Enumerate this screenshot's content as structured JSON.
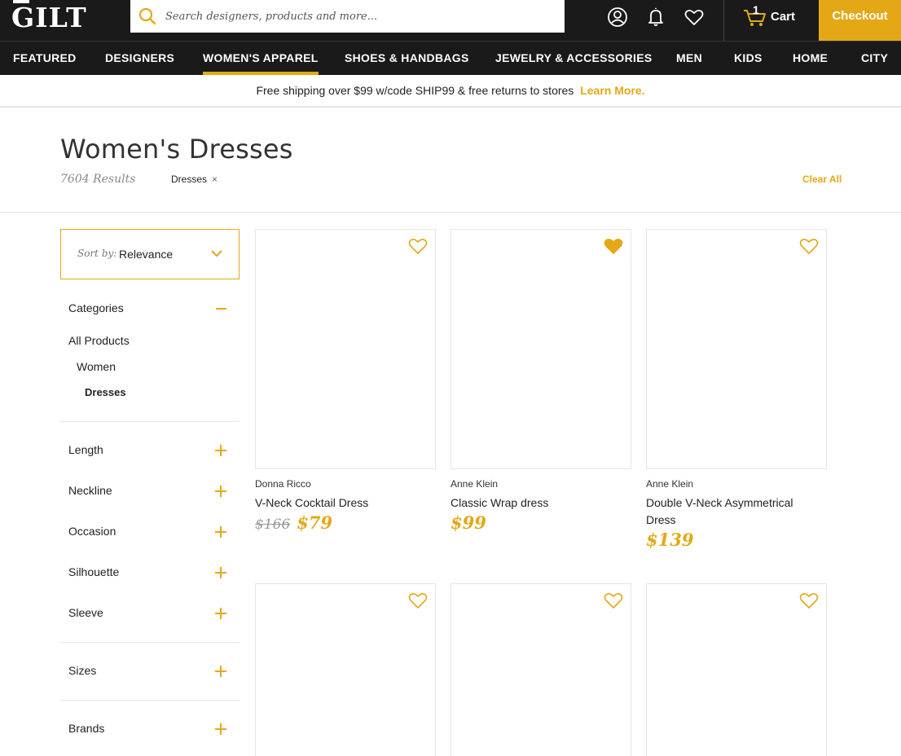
{
  "header": {
    "logo": "GILT",
    "search_placeholder": "Search designers, products and more...",
    "cart_count": "1",
    "cart_label": "Cart",
    "checkout_label": "Checkout"
  },
  "nav": {
    "items": [
      "FEATURED",
      "DESIGNERS",
      "WOMEN'S APPAREL",
      "SHOES & HANDBAGS",
      "JEWELRY & ACCESSORIES",
      "MEN",
      "KIDS",
      "HOME",
      "CITY"
    ],
    "active": "WOMEN'S APPAREL"
  },
  "promo": {
    "text": "Free shipping over $99 w/code SHIP99 & free returns to stores",
    "link": "Learn More."
  },
  "page": {
    "title": "Women's Dresses",
    "results": "7604 Results",
    "filter_chip": "Dresses",
    "clear_all": "Clear All"
  },
  "sidebar": {
    "sort_label": "Sort by:",
    "sort_value": "Relevance",
    "categories_heading": "Categories",
    "category_links": [
      "All Products",
      "Women",
      "Dresses"
    ],
    "facets": [
      "Length",
      "Neckline",
      "Occasion",
      "Silhouette",
      "Sleeve",
      "Sizes",
      "Brands"
    ]
  },
  "products": [
    {
      "brand": "Donna Ricco",
      "name": "V-Neck Cocktail Dress",
      "original_price": "$166",
      "price": "$79",
      "favorited": false,
      "dress_color": "#a3236f"
    },
    {
      "brand": "Anne Klein",
      "name": "Classic Wrap dress",
      "original_price": "",
      "price": "$99",
      "favorited": true,
      "dress_color": "#6b1f3a"
    },
    {
      "brand": "Anne Klein",
      "name": "Double V-Neck Asymmetrical Dress",
      "original_price": "",
      "price": "$139",
      "favorited": false,
      "dress_color": "#9b1f64"
    },
    {
      "brand": "",
      "name": "",
      "original_price": "",
      "price": "",
      "favorited": false,
      "dress_color": "#8e1c58"
    },
    {
      "brand": "",
      "name": "",
      "original_price": "",
      "price": "",
      "favorited": false,
      "dress_color": "#22222b"
    },
    {
      "brand": "",
      "name": "",
      "original_price": "",
      "price": "",
      "favorited": false,
      "dress_color": "#6b7148"
    }
  ],
  "colors": {
    "accent": "#e4a817",
    "header_bg": "#1a1a1a"
  }
}
